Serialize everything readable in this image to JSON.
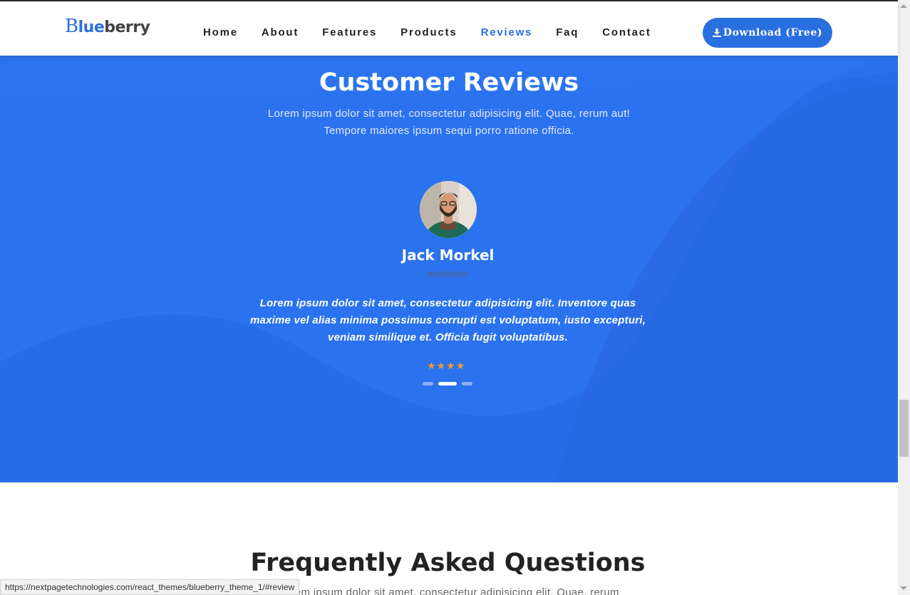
{
  "brand": {
    "logo_b": "B",
    "logo_lue": "lue",
    "logo_rest": "berry"
  },
  "nav": {
    "items": [
      {
        "label": "Home",
        "active": false
      },
      {
        "label": "About",
        "active": false
      },
      {
        "label": "Features",
        "active": false
      },
      {
        "label": "Products",
        "active": false
      },
      {
        "label": "Reviews",
        "active": true
      },
      {
        "label": "Faq",
        "active": false
      },
      {
        "label": "Contact",
        "active": false
      }
    ],
    "download_label": "Download (Free)",
    "download_icon": "download-icon"
  },
  "reviews": {
    "title": "Customer Reviews",
    "subtitle": "Lorem ipsum dolor sit amet, consectetur adipisicing elit. Quae, rerum aut! Tempore maiores ipsum sequi porro ratione officia.",
    "reviewer_name": "Jack Morkel",
    "reviewer_role": "marketer",
    "quote": "Lorem ipsum dolor sit amet, consectetur adipisicing elit. Inventore quas maxime vel alias minima possimus corrupti est voluptatum, iusto excepturi, veniam similique et. Officia fugit voluptatibus.",
    "rating": 4,
    "star_glyph": "★",
    "carousel_slides": 3,
    "carousel_active": 1
  },
  "faq": {
    "title": "Frequently Asked Questions",
    "subtitle": "Lorem ipsum dolor sit amet, consectetur adipisicing elit. Quae, rerum"
  },
  "status_url": "https://nextpagetechnologies.com/react_themes/blueberry_theme_1/#review",
  "colors": {
    "accent": "#2a6fe0",
    "section_bg": "#2b72ee",
    "star": "#f39c2b"
  }
}
